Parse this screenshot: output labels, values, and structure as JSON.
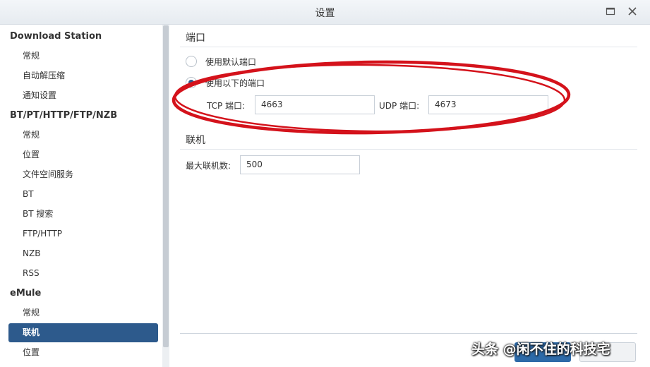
{
  "window": {
    "title": "设置"
  },
  "sidebar": {
    "groups": [
      {
        "label": "Download Station",
        "items": [
          "常规",
          "自动解压缩",
          "通知设置"
        ]
      },
      {
        "label": "BT/PT/HTTP/FTP/NZB",
        "items": [
          "常规",
          "位置",
          "文件空间服务",
          "BT",
          "BT 搜索",
          "FTP/HTTP",
          "NZB",
          "RSS"
        ]
      },
      {
        "label": "eMule",
        "items": [
          "常规",
          "联机",
          "位置"
        ]
      }
    ],
    "selected": "联机"
  },
  "port_section": {
    "title": "端口",
    "option_default": "使用默认端口",
    "option_custom": "使用以下的端口",
    "selected_option": "custom",
    "tcp_label": "TCP 端口:",
    "tcp_value": "4663",
    "udp_label": "UDP 端口:",
    "udp_value": "4673"
  },
  "connection_section": {
    "title": "联机",
    "max_label": "最大联机数:",
    "max_value": "500"
  },
  "annotation": {
    "ellipse_color": "#d4121b"
  },
  "watermark": {
    "text": "头条 @闲不住的科技宅"
  }
}
